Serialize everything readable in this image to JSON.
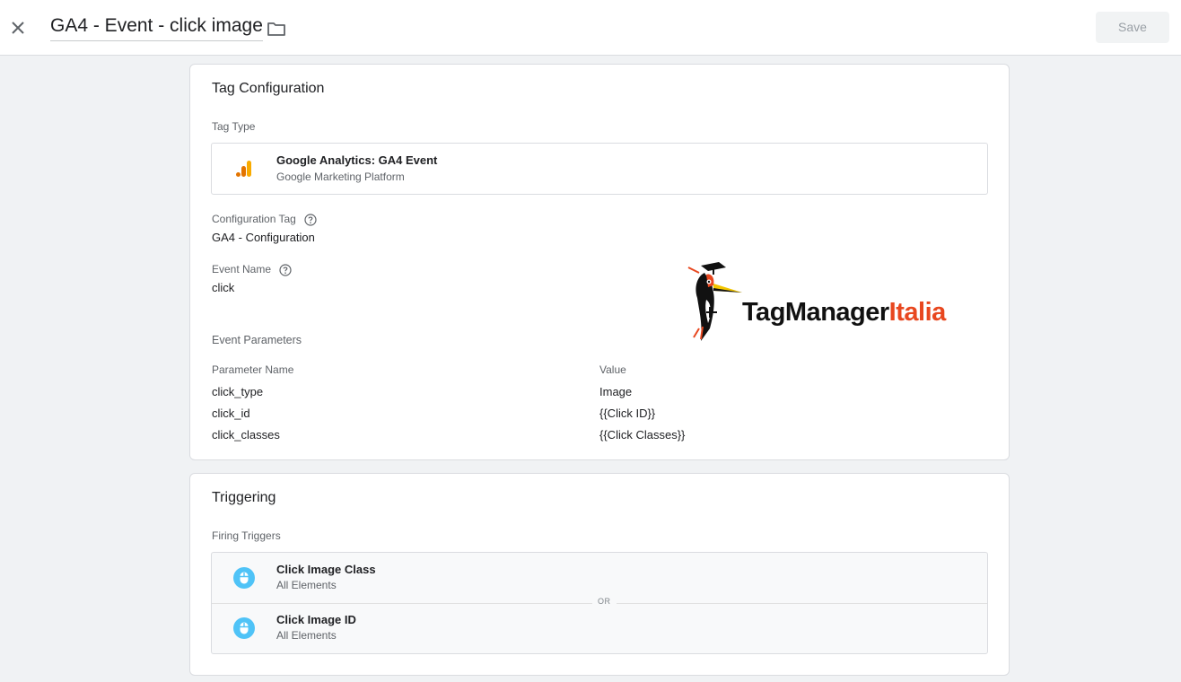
{
  "header": {
    "title": "GA4 - Event - click image",
    "save_label": "Save"
  },
  "tag_configuration": {
    "title": "Tag Configuration",
    "tag_type_label": "Tag Type",
    "tag_type": {
      "name": "Google Analytics: GA4 Event",
      "provider": "Google Marketing Platform",
      "icon": "ga4-bars-icon"
    },
    "configuration_tag_label": "Configuration Tag",
    "configuration_tag_value": "GA4 - Configuration",
    "event_name_label": "Event Name",
    "event_name_value": "click",
    "event_parameters_label": "Event Parameters",
    "parameter_name_header": "Parameter Name",
    "value_header": "Value",
    "parameters": [
      {
        "name": "click_type",
        "value": "Image"
      },
      {
        "name": "click_id",
        "value": "{{Click ID}}"
      },
      {
        "name": "click_classes",
        "value": "{{Click Classes}}"
      }
    ]
  },
  "watermark": {
    "part1": "TagManager",
    "part2": "Italia"
  },
  "triggering": {
    "title": "Triggering",
    "firing_triggers_label": "Firing Triggers",
    "separator": "OR",
    "triggers": [
      {
        "name": "Click Image Class",
        "sub": "All Elements",
        "icon": "mouse-click-icon"
      },
      {
        "name": "Click Image ID",
        "sub": "All Elements",
        "icon": "mouse-click-icon"
      }
    ]
  },
  "colors": {
    "ga4_orange": "#f9ab00",
    "ga4_dark_orange": "#e37400",
    "trigger_blue": "#4fc3f7",
    "logo_orange": "#e8471f"
  }
}
